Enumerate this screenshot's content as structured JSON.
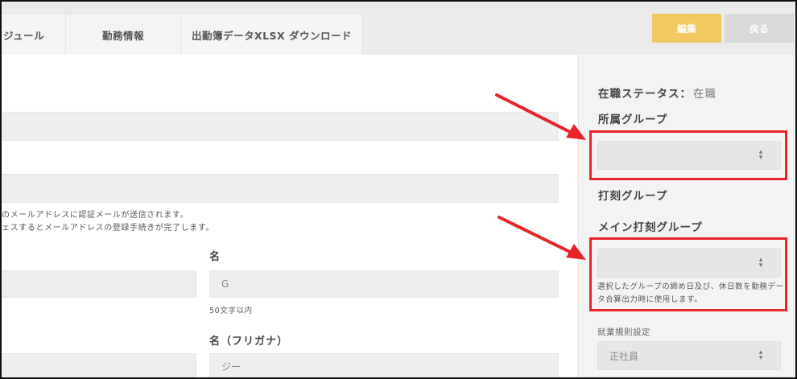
{
  "tabs": [
    "ジュール",
    "勤務情報",
    "出勤簿データXLSX ダウンロード"
  ],
  "actions": {
    "edit": "編集",
    "back": "戻る"
  },
  "form": {
    "email_help_1": "のメールアドレスに認証メールが送信されます。",
    "email_help_2": "ェスするとメールアドレスの登録手続きが完了します。",
    "first_name_label": "名",
    "first_name_value": "G",
    "first_name_help": "50文字以内",
    "first_name_kana_label": "名（フリガナ）",
    "first_name_kana_value": "ジー"
  },
  "side": {
    "status_label": "在職ステータス：",
    "status_value": "在職",
    "group_label": "所属グループ",
    "group_value": "",
    "punch_group_label": "打刻グループ",
    "main_punch_group_label": "メイン打刻グループ",
    "main_punch_group_value": "",
    "main_punch_note": "選択したグループの締め日及び、休日数を勤務データ合算出力時に使用します。",
    "work_rule_label": "就業規則設定",
    "work_rule_value": "正社員"
  },
  "icons": {
    "select_arrow": "updown-caret-icon",
    "annotation": "red-arrow-icon"
  },
  "colors": {
    "edit_button": "#f0c960",
    "back_button": "#d9d9d9",
    "highlight": "#e8242b"
  }
}
